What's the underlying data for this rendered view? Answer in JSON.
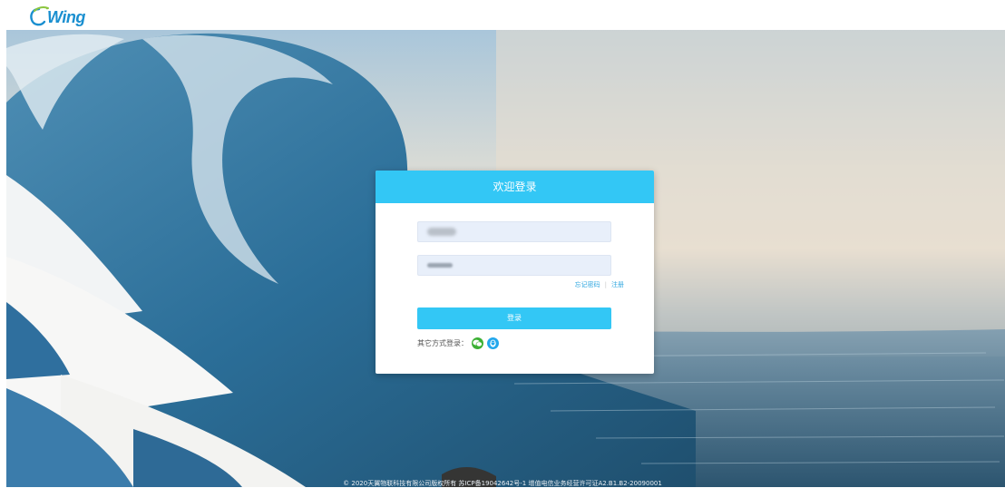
{
  "brand": {
    "logo_text": "Wing"
  },
  "login": {
    "title": "欢迎登录",
    "forgot_link": "忘记密码",
    "separator": "|",
    "register_link": "注册",
    "submit_label": "登录",
    "other_login_label": "其它方式登录：",
    "other_methods": [
      "wechat-icon",
      "qq-icon"
    ]
  },
  "footer": {
    "text": "© 2020天翼物联科技有限公司版权所有 苏ICP备19042642号-1  增值电信业务经营许可证A2.B1.B2-20090001"
  },
  "colors": {
    "accent": "#33c7f5",
    "link": "#33a8e0",
    "input_bg": "#e8effa",
    "wechat": "#3cb034",
    "qq": "#22a7ec"
  }
}
